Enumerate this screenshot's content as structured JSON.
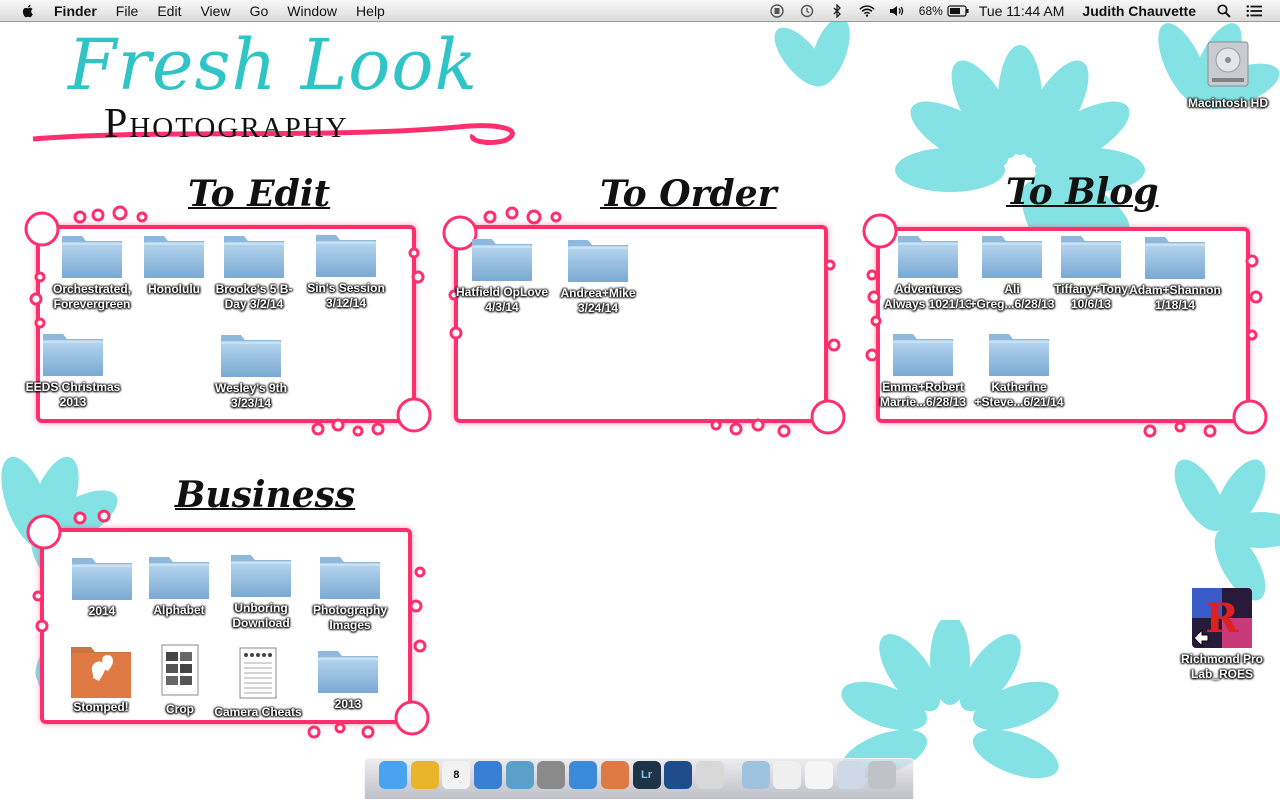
{
  "menubar": {
    "app_name": "Finder",
    "menus": [
      "File",
      "Edit",
      "View",
      "Go",
      "Window",
      "Help"
    ],
    "battery": "68%",
    "clock": "Tue 11:44 AM",
    "user": "Judith Chauvette",
    "status_icons": [
      "airplay-icon",
      "time-machine-icon",
      "bluetooth-icon",
      "wifi-icon",
      "volume-icon",
      "battery-icon",
      "spotlight-icon",
      "notification-center-icon"
    ]
  },
  "wallpaper": {
    "logo_script": "Fresh Look",
    "logo_sub": "Photography",
    "accent": "#ff2f6e",
    "flower_color": "#6fdde0",
    "logo_color": "#2fc4c6"
  },
  "sections": {
    "to_edit": "To Edit",
    "to_order": "To Order",
    "to_blog": "To Blog",
    "business": "Business"
  },
  "desktop_items": {
    "to_edit": [
      {
        "label": "Orchestrated,\nForevergreen",
        "type": "folder"
      },
      {
        "label": "Honolulu",
        "type": "folder"
      },
      {
        "label": "Brooke's 5 B-\nDay 3/2/14",
        "type": "folder"
      },
      {
        "label": "Sin's Session\n3/12/14",
        "type": "folder"
      },
      {
        "label": "EEDS Christmas\n2013",
        "type": "folder"
      },
      {
        "label": "Wesley's 9th\n3/23/14",
        "type": "folder"
      }
    ],
    "to_order": [
      {
        "label": "Hatfield OpLove\n4/3/14",
        "type": "folder"
      },
      {
        "label": "Andrea+Mike\n3/24/14",
        "type": "folder"
      }
    ],
    "to_blog": [
      {
        "label": "Adventures\nAlways 1021/13",
        "type": "folder"
      },
      {
        "label": "Ali\n+Greg...6/28/13",
        "type": "folder"
      },
      {
        "label": "Tiffany+Tony\n10/6/13",
        "type": "folder"
      },
      {
        "label": "Adam+Shannon\n1/18/14",
        "type": "folder"
      },
      {
        "label": "Emma+Robert\nMarrie...6/28/13",
        "type": "folder"
      },
      {
        "label": "Katherine\n+Steve...6/21/14",
        "type": "folder"
      }
    ],
    "business": [
      {
        "label": "2014",
        "type": "folder"
      },
      {
        "label": "Alphabet",
        "type": "folder"
      },
      {
        "label": "Unboring\nDownload",
        "type": "folder"
      },
      {
        "label": "Photography\nImages",
        "type": "folder"
      },
      {
        "label": "Stomped!",
        "type": "app"
      },
      {
        "label": "Crop",
        "type": "document"
      },
      {
        "label": "Camera Cheats",
        "type": "document"
      },
      {
        "label": "2013",
        "type": "folder"
      }
    ],
    "drives": [
      {
        "label": "Macintosh HD",
        "type": "drive"
      },
      {
        "label": "Richmond Pro\nLab_ROES",
        "type": "alias-app"
      }
    ]
  },
  "dock": {
    "apps": [
      {
        "name": "finder-icon",
        "color": "#4aa3f0",
        "text": ""
      },
      {
        "name": "chrome-icon",
        "color": "#e8b52a",
        "text": ""
      },
      {
        "name": "calendar-icon",
        "color": "#f2f2f2",
        "text": "8"
      },
      {
        "name": "itunes-icon",
        "color": "#3a7fd6",
        "text": ""
      },
      {
        "name": "iphoto-icon",
        "color": "#5aa0c8",
        "text": ""
      },
      {
        "name": "system-preferences-icon",
        "color": "#8a8a8a",
        "text": ""
      },
      {
        "name": "app-store-icon",
        "color": "#3b8ad9",
        "text": ""
      },
      {
        "name": "stomped-icon",
        "color": "#e07a45",
        "text": ""
      },
      {
        "name": "lightroom-icon",
        "color": "#1d3346",
        "text": "Lr"
      },
      {
        "name": "photo-app-icon",
        "color": "#1f4d8c",
        "text": ""
      },
      {
        "name": "preview-icon",
        "color": "#d8d8d8",
        "text": ""
      },
      {
        "name": "applications-folder-icon",
        "color": "#9fc3df",
        "text": ""
      },
      {
        "name": "documents-stack-icon",
        "color": "#f0f0f0",
        "text": ""
      },
      {
        "name": "file-stack-icon",
        "color": "#f5f5f5",
        "text": ""
      },
      {
        "name": "downloads-stack-icon",
        "color": "#cfd8e6",
        "text": ""
      },
      {
        "name": "trash-icon",
        "color": "#bfc3c8",
        "text": ""
      }
    ]
  }
}
